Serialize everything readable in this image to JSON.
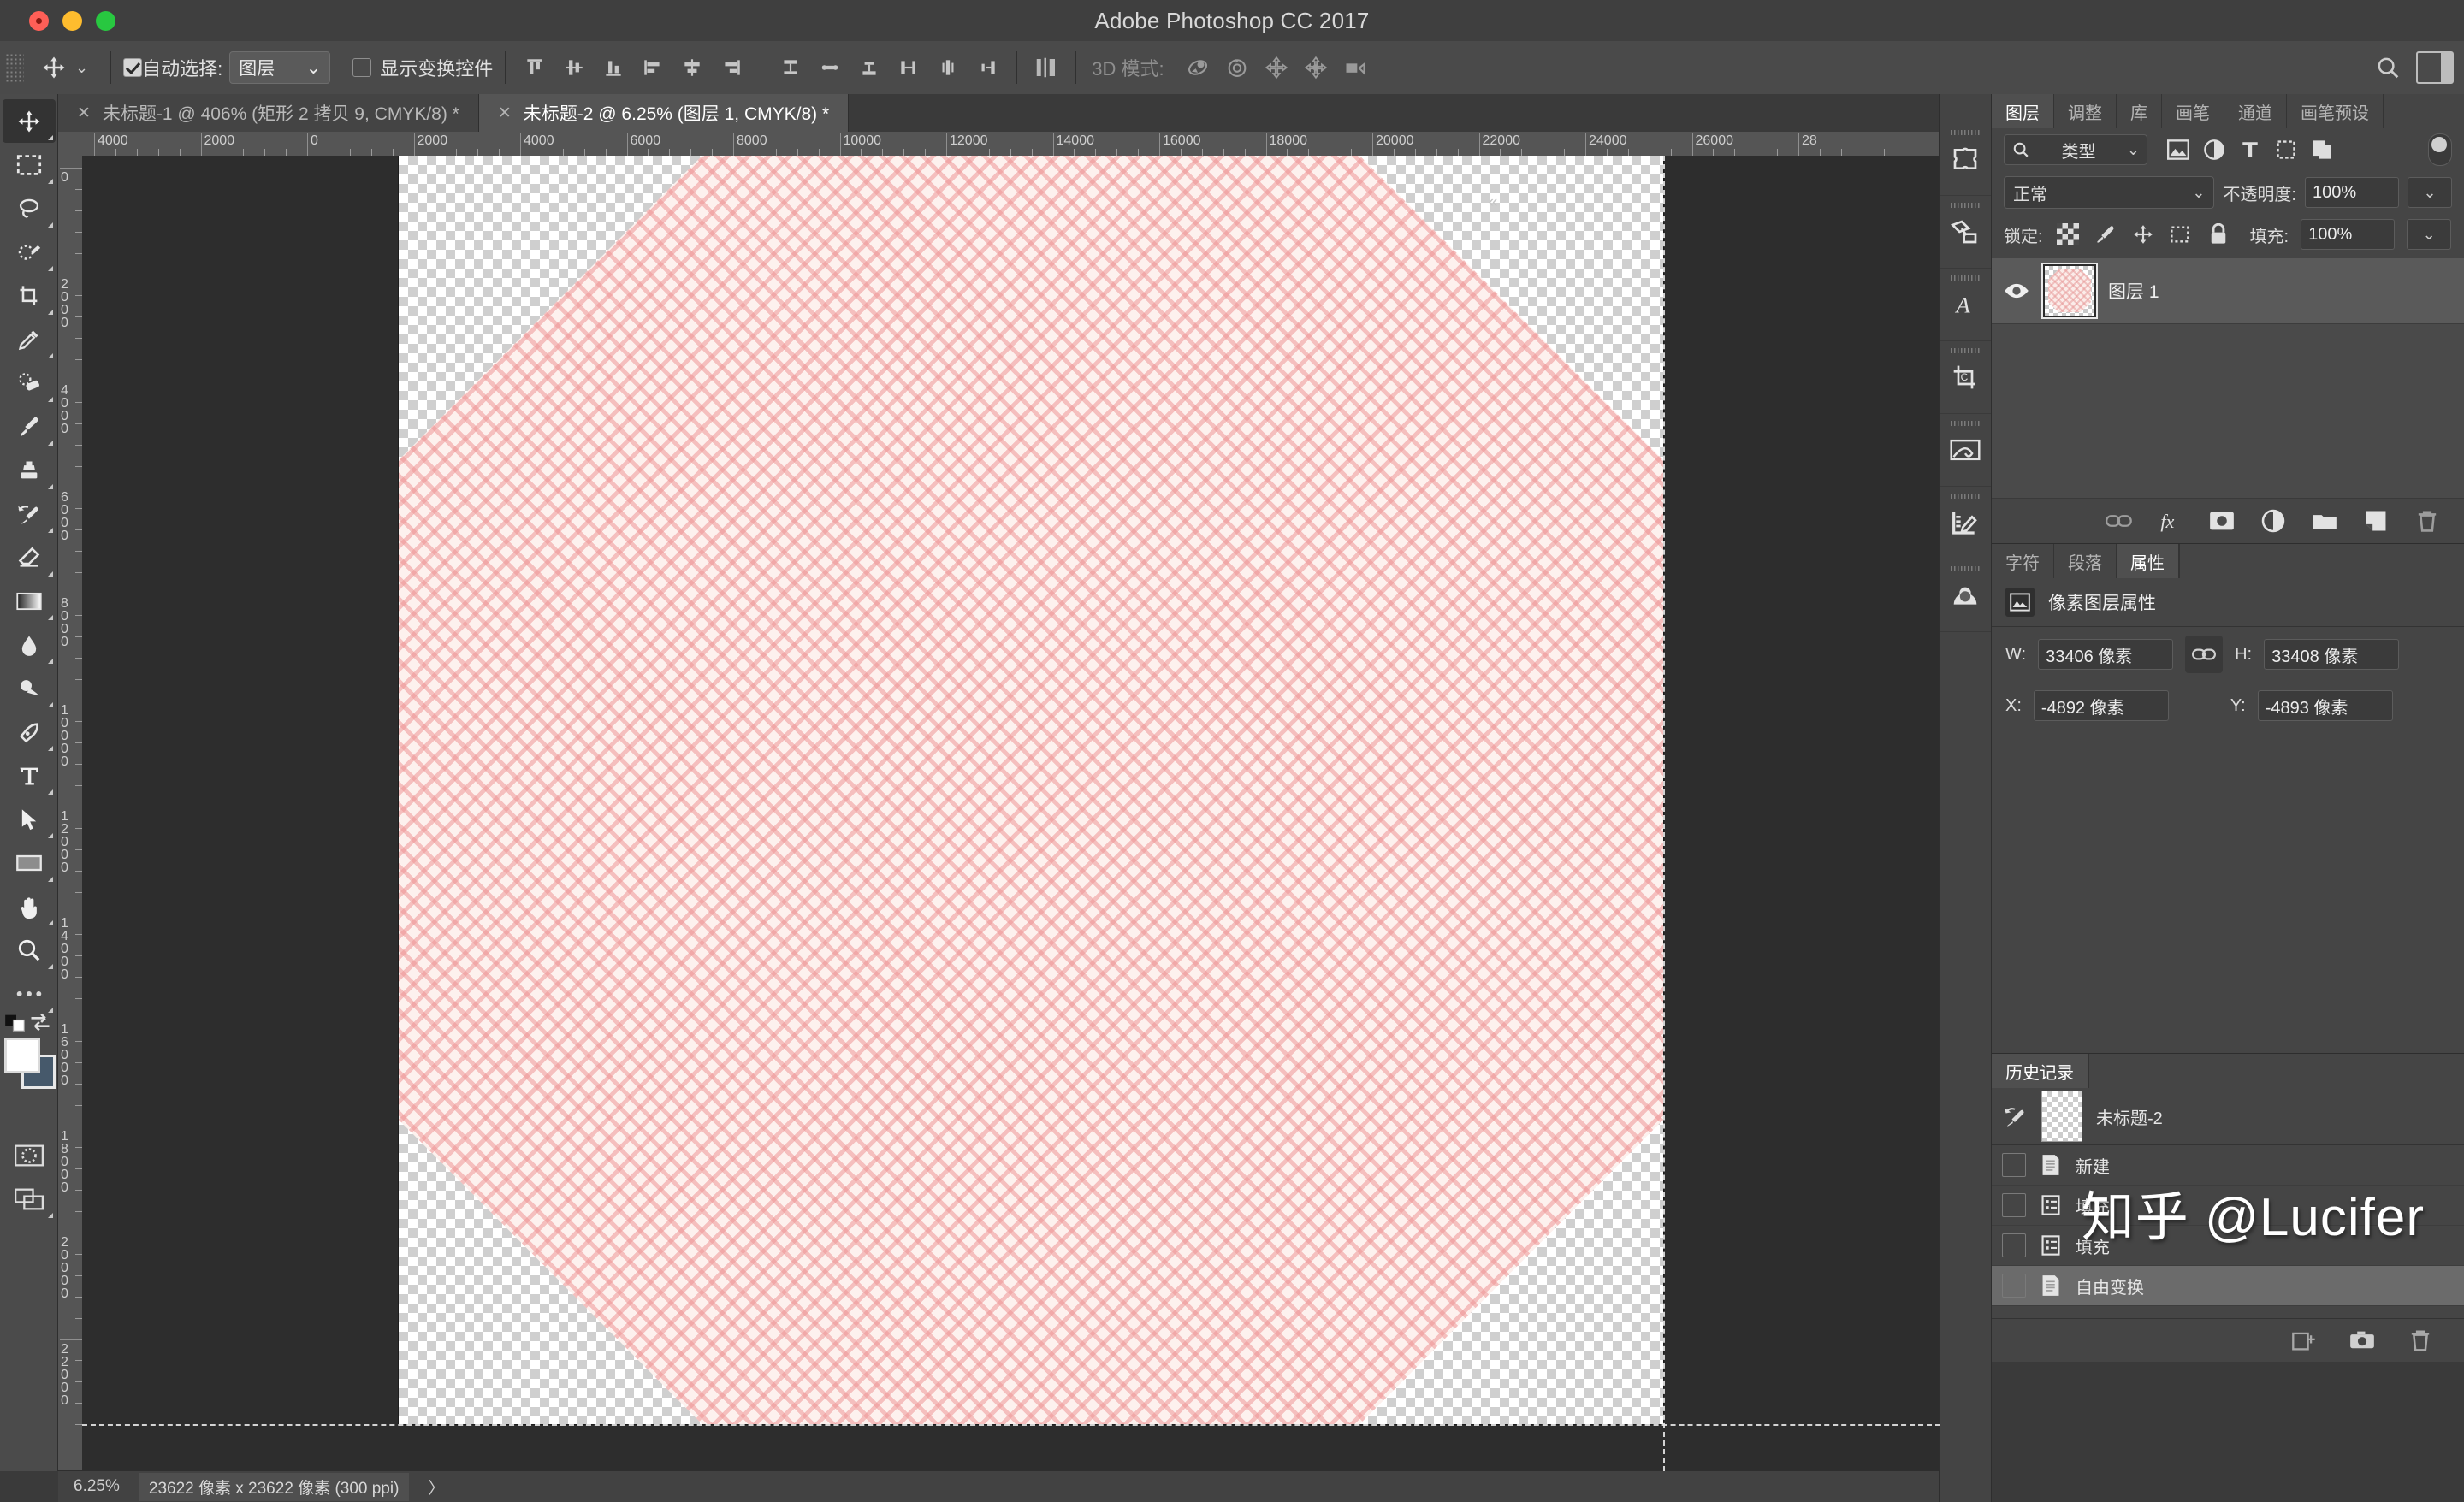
{
  "window": {
    "title": "Adobe Photoshop CC 2017",
    "controls": [
      {
        "name": "close"
      },
      {
        "name": "minimize"
      },
      {
        "name": "zoom"
      }
    ]
  },
  "options_bar": {
    "tool_icon": "move-tool-icon",
    "auto_select_label": "自动选择:",
    "auto_select_checked": true,
    "auto_select_value": "图层",
    "show_transform_label": "显示变换控件",
    "show_transform_checked": false,
    "mode_3d_label": "3D 模式:",
    "align_icons": [
      "align-top-edges-icon",
      "align-vertical-centers-icon",
      "align-bottom-edges-icon",
      "align-left-edges-icon",
      "align-horizontal-centers-icon",
      "align-right-edges-icon"
    ],
    "distribute_icons": [
      "distribute-top-edges-icon",
      "distribute-vertical-centers-icon",
      "distribute-bottom-edges-icon",
      "distribute-left-edges-icon",
      "distribute-horizontal-centers-icon",
      "distribute-right-edges-icon"
    ],
    "extra_icon": "distribute-spacing-icon",
    "icons_3d": [
      "rotate-3d-icon",
      "roll-3d-icon",
      "pan-3d-icon",
      "slide-3d-icon",
      "camera-3d-icon"
    ],
    "search_icon": "search-icon",
    "workspace_icon": "workspace-switcher-icon"
  },
  "toolbox": [
    {
      "name": "move-tool",
      "icon": "move-tool-icon",
      "active": true
    },
    {
      "name": "marquee-tool",
      "icon": "rectangular-marquee-icon",
      "active": false
    },
    {
      "name": "lasso-tool",
      "icon": "lasso-icon",
      "active": false
    },
    {
      "name": "quick-selection-tool",
      "icon": "quick-selection-icon",
      "active": false
    },
    {
      "name": "crop-tool",
      "icon": "crop-icon",
      "active": false
    },
    {
      "name": "eyedropper-tool",
      "icon": "eyedropper-icon",
      "active": false
    },
    {
      "name": "healing-brush-tool",
      "icon": "spot-healing-icon",
      "active": false
    },
    {
      "name": "brush-tool",
      "icon": "brush-icon",
      "active": false
    },
    {
      "name": "clone-stamp-tool",
      "icon": "clone-stamp-icon",
      "active": false
    },
    {
      "name": "history-brush-tool",
      "icon": "history-brush-icon",
      "active": false
    },
    {
      "name": "eraser-tool",
      "icon": "eraser-icon",
      "active": false
    },
    {
      "name": "gradient-tool",
      "icon": "gradient-icon",
      "active": false
    },
    {
      "name": "blur-tool",
      "icon": "blur-drop-icon",
      "active": false
    },
    {
      "name": "dodge-tool",
      "icon": "dodge-icon",
      "active": false
    },
    {
      "name": "pen-tool",
      "icon": "pen-icon",
      "active": false
    },
    {
      "name": "type-tool",
      "icon": "type-icon",
      "active": false
    },
    {
      "name": "path-selection-tool",
      "icon": "path-selection-arrow-icon",
      "active": false
    },
    {
      "name": "rectangle-tool",
      "icon": "rectangle-icon",
      "active": false
    },
    {
      "name": "hand-tool",
      "icon": "hand-icon",
      "active": false
    },
    {
      "name": "zoom-tool",
      "icon": "magnifier-icon",
      "active": false
    },
    {
      "name": "edit-toolbar",
      "icon": "ellipsis-icon",
      "active": false
    }
  ],
  "toolbox_bottom": {
    "swap_icon": "swap-colors-icon",
    "default_colors_icon": "default-colors-icon",
    "quick_mask_icon": "quick-mask-icon",
    "screen_mode_icon": "screen-mode-icon"
  },
  "tabs": [
    {
      "label": "未标题-1 @ 406% (矩形 2 拷贝 9, CMYK/8) *",
      "active": false
    },
    {
      "label": "未标题-2 @ 6.25% (图层 1, CMYK/8) *",
      "active": true
    }
  ],
  "ruler": {
    "horizontal": [
      "4000",
      "2000",
      "0",
      "2000",
      "4000",
      "6000",
      "8000",
      "10000",
      "12000",
      "14000",
      "16000",
      "18000",
      "20000",
      "22000",
      "24000",
      "26000",
      "28"
    ],
    "vertical": [
      "0",
      "2000",
      "4000",
      "6000",
      "8000",
      "10000",
      "12000",
      "14000",
      "16000",
      "18000",
      "20000",
      "22000"
    ]
  },
  "statusbar": {
    "zoom": "6.25%",
    "doc_info": "23622 像素 x 23622 像素 (300 ppi)",
    "chevron": "〉"
  },
  "dock_strip": [
    {
      "name": "plugin-panel",
      "icon": "puzzle-icon"
    },
    {
      "name": "3d-panel",
      "icon": "3d-plane-icon"
    },
    {
      "name": "glyphs-panel",
      "icon": "glyph-a-icon"
    },
    {
      "name": "crop-panel",
      "icon": "crop-frame-icon"
    },
    {
      "name": "paths-panel",
      "icon": "path-curve-icon"
    },
    {
      "name": "measure-panel",
      "icon": "ruler-pencil-icon"
    },
    {
      "name": "mask-panel",
      "icon": "mask-portrait-icon"
    }
  ],
  "layers_panel": {
    "tabs": [
      {
        "label": "图层",
        "active": true
      },
      {
        "label": "调整",
        "active": false
      },
      {
        "label": "库",
        "active": false
      },
      {
        "label": "画笔",
        "active": false
      },
      {
        "label": "通道",
        "active": false
      },
      {
        "label": "画笔预设",
        "active": false
      }
    ],
    "filter": {
      "label": "类型",
      "icon": "search-icon",
      "type_icons": [
        "pixel-filter-icon",
        "adjustment-filter-icon",
        "type-filter-icon",
        "shape-filter-icon",
        "smart-object-filter-icon"
      ],
      "toggle": "filter-toggle-icon"
    },
    "blend_mode": "正常",
    "opacity_label": "不透明度:",
    "opacity_value": "100%",
    "lock_label": "锁定:",
    "lock_icons": [
      "lock-transparent-pixels-icon",
      "lock-image-pixels-icon",
      "lock-position-icon",
      "lock-artboard-icon",
      "lock-all-icon"
    ],
    "fill_label": "填充:",
    "fill_value": "100%",
    "layers": [
      {
        "name": "图层 1",
        "visible": true,
        "selected": true,
        "visibility_icon": "eye-icon"
      }
    ],
    "footer_icons": [
      "link-layers-icon",
      "layer-style-fx-icon",
      "add-layer-mask-icon",
      "new-adjustment-layer-icon",
      "new-group-icon",
      "new-layer-icon",
      "delete-layer-icon"
    ]
  },
  "properties_panel": {
    "tabs": [
      {
        "label": "字符",
        "active": false
      },
      {
        "label": "段落",
        "active": false
      },
      {
        "label": "属性",
        "active": true
      }
    ],
    "header_title": "像素图层属性",
    "header_icon": "pixel-layer-icon",
    "link_icon": "link-dimensions-icon",
    "fields": [
      {
        "label": "W:",
        "value": "33406 像素",
        "name": "width-field"
      },
      {
        "label": "H:",
        "value": "33408 像素",
        "name": "height-field"
      },
      {
        "label": "X:",
        "value": "-4892 像素",
        "name": "x-position-field"
      },
      {
        "label": "Y:",
        "value": "-4893 像素",
        "name": "y-position-field"
      }
    ]
  },
  "history_panel": {
    "tabs": [
      {
        "label": "历史记录",
        "active": true
      }
    ],
    "snapshot": {
      "label": "未标题-2",
      "brush_icon": "history-brush-icon"
    },
    "items": [
      {
        "label": "新建",
        "icon": "new-document-icon",
        "selected": false
      },
      {
        "label": "填充",
        "icon": "fill-icon",
        "selected": false
      },
      {
        "label": "填充",
        "icon": "fill-icon",
        "selected": false
      },
      {
        "label": "自由变换",
        "icon": "free-transform-icon",
        "selected": true
      }
    ],
    "footer_icons": [
      "new-document-from-state-icon",
      "new-snapshot-icon",
      "delete-state-icon"
    ]
  },
  "watermark": "知乎 @Lucifer",
  "colors": {
    "accent": "#555555",
    "panel_bg": "#454545",
    "canvas_bg": "#2d2d2d",
    "pattern_pink": "#ee9696",
    "pattern_base": "#fdf1ee",
    "foreground_swatch": "#ffffff",
    "background_swatch": "#46596b"
  }
}
